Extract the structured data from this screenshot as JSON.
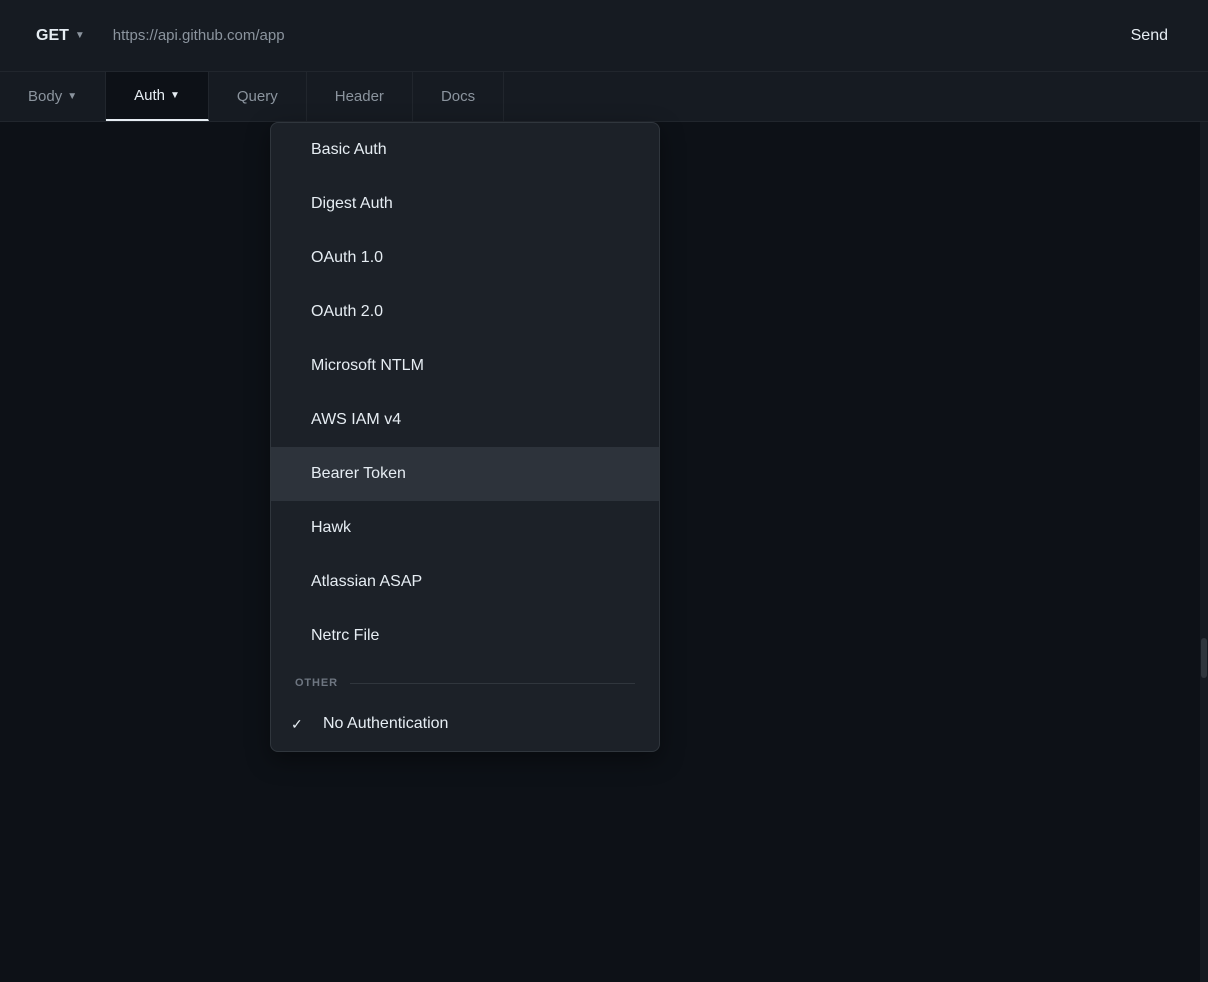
{
  "topbar": {
    "method": "GET",
    "method_chevron": "▼",
    "url": "https://api.github.com/app",
    "send_label": "Send"
  },
  "tabs": [
    {
      "id": "body",
      "label": "Body",
      "has_chevron": true,
      "active": false
    },
    {
      "id": "auth",
      "label": "Auth",
      "has_chevron": true,
      "active": true
    },
    {
      "id": "query",
      "label": "Query",
      "has_chevron": false,
      "active": false
    },
    {
      "id": "header",
      "label": "Header",
      "has_chevron": false,
      "active": false
    },
    {
      "id": "docs",
      "label": "Docs",
      "has_chevron": false,
      "active": false
    }
  ],
  "dropdown": {
    "items": [
      {
        "id": "basic-auth",
        "label": "Basic Auth",
        "selected": false,
        "checkmark": false
      },
      {
        "id": "digest-auth",
        "label": "Digest Auth",
        "selected": false,
        "checkmark": false
      },
      {
        "id": "oauth1",
        "label": "OAuth 1.0",
        "selected": false,
        "checkmark": false
      },
      {
        "id": "oauth2",
        "label": "OAuth 2.0",
        "selected": false,
        "checkmark": false
      },
      {
        "id": "microsoft-ntlm",
        "label": "Microsoft NTLM",
        "selected": false,
        "checkmark": false
      },
      {
        "id": "aws-iam",
        "label": "AWS IAM v4",
        "selected": false,
        "checkmark": false
      },
      {
        "id": "bearer-token",
        "label": "Bearer Token",
        "selected": true,
        "checkmark": false
      },
      {
        "id": "hawk",
        "label": "Hawk",
        "selected": false,
        "checkmark": false
      },
      {
        "id": "atlassian-asap",
        "label": "Atlassian ASAP",
        "selected": false,
        "checkmark": false
      },
      {
        "id": "netrc-file",
        "label": "Netrc File",
        "selected": false,
        "checkmark": false
      }
    ],
    "other_section_label": "OTHER",
    "no_auth": {
      "label": "No Authentication",
      "checked": true
    }
  },
  "colors": {
    "bg_primary": "#0d1117",
    "bg_secondary": "#161b22",
    "bg_dropdown": "#1c2128",
    "bg_selected": "#2d333b",
    "border": "#30363d",
    "text_primary": "#e6edf3",
    "text_muted": "#8b949e",
    "text_dimmer": "#6e7681"
  }
}
